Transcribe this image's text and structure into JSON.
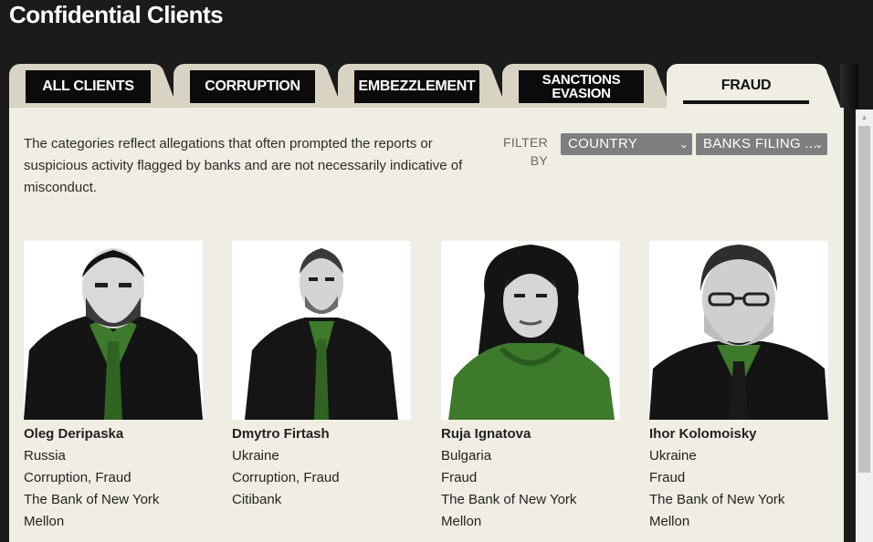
{
  "page": {
    "title": "Confidential Clients"
  },
  "tabs": [
    {
      "label": "ALL CLIENTS"
    },
    {
      "label": "CORRUPTION"
    },
    {
      "label": "EMBEZZLEMENT"
    },
    {
      "label_line1": "SANCTIONS",
      "label_line2": "EVASION"
    },
    {
      "label": "FRAUD",
      "active": true
    }
  ],
  "description": "The categories reflect allegations that often prompted the reports or suspicious activity flagged by banks and are not necessarily indicative of misconduct.",
  "filter": {
    "label": "FILTER BY",
    "country_select": "COUNTRY",
    "banks_select": "BANKS FILING ..."
  },
  "clients": [
    {
      "name": "Oleg Deripaska",
      "country": "Russia",
      "categories": "Corruption, Fraud",
      "bank_line1": "The Bank of New York",
      "bank_line2": "Mellon"
    },
    {
      "name": "Dmytro Firtash",
      "country": "Ukraine",
      "categories": "Corruption, Fraud",
      "bank_line1": "Citibank",
      "bank_line2": ""
    },
    {
      "name": "Ruja Ignatova",
      "country": "Bulgaria",
      "categories": "Fraud",
      "bank_line1": "The Bank of New York",
      "bank_line2": "Mellon"
    },
    {
      "name": "Ihor Kolomoisky",
      "country": "Ukraine",
      "categories": "Fraud",
      "bank_line1": "The Bank of New York",
      "bank_line2": "Mellon"
    }
  ],
  "colors": {
    "background": "#1b1b1b",
    "panel": "#f0eee3",
    "tab_inactive": "#d8d3c2",
    "tab_label_bg": "#0b0b0b",
    "select_bg": "#7e7e7e",
    "shirt_green": "#3d7a2c"
  },
  "icons": {
    "select_arrow": "chevron-down-icon",
    "scroll_up": "scroll-up-arrow-icon"
  }
}
